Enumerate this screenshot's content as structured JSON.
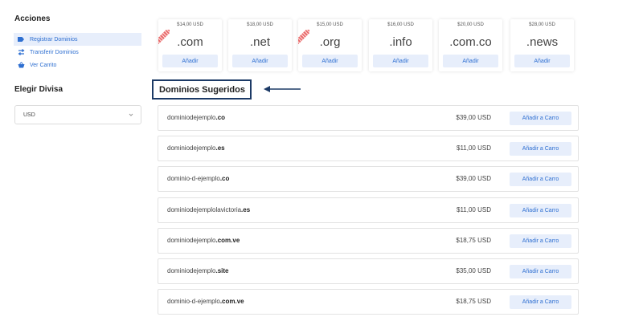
{
  "sidebar": {
    "acciones_title": "Acciones",
    "actions": [
      {
        "label": "Registrar Dominios",
        "icon": "tag-icon"
      },
      {
        "label": "Transferir Dominios",
        "icon": "transfer-icon"
      },
      {
        "label": "Ver Carrito",
        "icon": "cart-icon"
      }
    ],
    "divisa_title": "Elegir Divisa",
    "currency_selected": "USD"
  },
  "tlds": [
    {
      "price": "$14,00 USD",
      "name": ".com",
      "button": "Añadir",
      "sale": true
    },
    {
      "price": "$18,00 USD",
      "name": ".net",
      "button": "Añadir",
      "sale": false
    },
    {
      "price": "$15,00 USD",
      "name": ".org",
      "button": "Añadir",
      "sale": true
    },
    {
      "price": "$16,00 USD",
      "name": ".info",
      "button": "Añadir",
      "sale": false
    },
    {
      "price": "$20,00 USD",
      "name": ".com.co",
      "button": "Añadir",
      "sale": false
    },
    {
      "price": "$28,00 USD",
      "name": ".news",
      "button": "Añadir",
      "sale": false
    }
  ],
  "suggested_title": "Dominios Sugeridos",
  "suggestions": [
    {
      "base": "dominiodejemplo",
      "tld": ".co",
      "price": "$39,00 USD",
      "button": "Añadir a Carro"
    },
    {
      "base": "dominiodejemplo",
      "tld": ".es",
      "price": "$11,00 USD",
      "button": "Añadir a Carro"
    },
    {
      "base": "dominio-d-ejemplo",
      "tld": ".co",
      "price": "$39,00 USD",
      "button": "Añadir a Carro"
    },
    {
      "base": "dominiodejemplolavictoria",
      "tld": ".es",
      "price": "$11,00 USD",
      "button": "Añadir a Carro"
    },
    {
      "base": "dominiodejemplo",
      "tld": ".com.ve",
      "price": "$18,75 USD",
      "button": "Añadir a Carro"
    },
    {
      "base": "dominiodejemplo",
      "tld": ".site",
      "price": "$35,00 USD",
      "button": "Añadir a Carro"
    },
    {
      "base": "dominio-d-ejemplo",
      "tld": ".com.ve",
      "price": "$18,75 USD",
      "button": "Añadir a Carro"
    }
  ],
  "colors": {
    "accent": "#2e6fd1",
    "button_bg": "#e7eefb",
    "heading_border": "#1c3a66"
  }
}
